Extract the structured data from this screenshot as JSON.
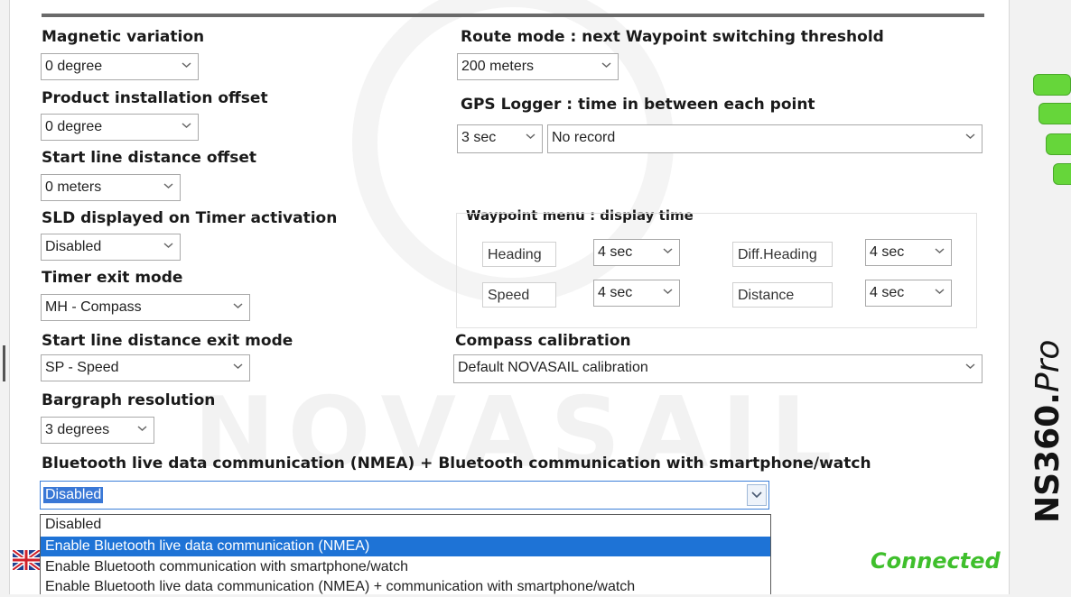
{
  "settings": {
    "magnetic_variation": {
      "label": "Magnetic variation",
      "value": "0 degree"
    },
    "product_installation_offset": {
      "label": "Product installation offset",
      "value": "0 degree"
    },
    "start_line_distance_offset": {
      "label": "Start line distance offset",
      "value": "0 meters"
    },
    "sld_on_timer": {
      "label": "SLD displayed on Timer activation",
      "value": "Disabled"
    },
    "timer_exit_mode": {
      "label": "Timer exit mode",
      "value": "MH - Compass"
    },
    "start_line_exit_mode": {
      "label": "Start line distance exit mode",
      "value": "SP - Speed"
    },
    "bargraph_resolution": {
      "label": "Bargraph resolution",
      "value": "3 degrees"
    },
    "route_mode": {
      "label": "Route mode : next Waypoint switching threshold",
      "value": "200 meters"
    },
    "gps_logger": {
      "label": "GPS Logger : time in between each point",
      "interval": "3 sec",
      "record": "No record"
    },
    "waypoint_menu": {
      "label": "Waypoint menu : display time",
      "items": [
        {
          "name": "Heading",
          "value": "4 sec"
        },
        {
          "name": "Diff.Heading",
          "value": "4 sec"
        },
        {
          "name": "Speed",
          "value": "4 sec"
        },
        {
          "name": "Distance",
          "value": "4 sec"
        }
      ]
    },
    "compass_calibration": {
      "label": "Compass calibration",
      "value": "Default NOVASAIL calibration"
    },
    "bluetooth": {
      "label": "Bluetooth live data communication (NMEA) + Bluetooth communication with smartphone/watch",
      "value": "Disabled",
      "options": [
        "Disabled",
        "Enable Bluetooth live data communication (NMEA)",
        "Enable Bluetooth communication with smartphone/watch",
        "Enable Bluetooth live data communication (NMEA) + communication with smartphone/watch"
      ],
      "highlighted_option": 1
    }
  },
  "status": {
    "connection": "Connected",
    "connection_color": "#3fbf2c"
  },
  "brand": {
    "name": "NS360.",
    "suffix": "Pro",
    "watermark": "NOVASAIL"
  },
  "colors": {
    "accent": "#1e73d6",
    "led": "#66d63a"
  },
  "icons": {
    "chevron": "chevron-down-icon",
    "flag": "uk-flag-icon"
  }
}
